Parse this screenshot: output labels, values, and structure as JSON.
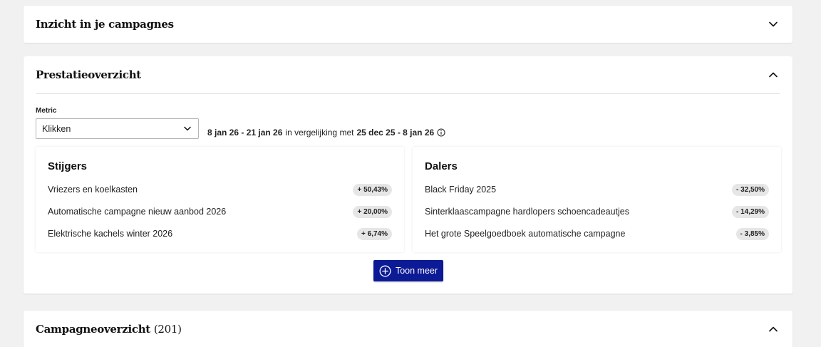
{
  "insights": {
    "title": "Inzicht in je campagnes"
  },
  "performance": {
    "title": "Prestatieoverzicht",
    "metric_label": "Metric",
    "metric_value": "Klikken",
    "range": {
      "current": "8 jan 26 - 21 jan 26",
      "connector": "in vergelijking met",
      "previous": "25 dec 25 - 8 jan 26"
    },
    "risers": {
      "title": "Stijgers",
      "items": [
        {
          "name": "Vriezers en koelkasten",
          "change": "+ 50,43%"
        },
        {
          "name": "Automatische campagne nieuw aanbod 2026",
          "change": "+ 20,00%"
        },
        {
          "name": "Elektrische kachels winter 2026",
          "change": "+ 6,74%"
        }
      ]
    },
    "fallers": {
      "title": "Dalers",
      "items": [
        {
          "name": "Black Friday 2025",
          "change": "- 32,50%"
        },
        {
          "name": "Sinterklaascampagne hardlopers schoencadeautjes",
          "change": "- 14,29%"
        },
        {
          "name": "Het grote Speelgoedboek automatische campagne",
          "change": "- 3,85%"
        }
      ]
    },
    "show_more": "Toon meer"
  },
  "campaigns": {
    "title": "Campagneoverzicht",
    "count": "(201)"
  },
  "colors": {
    "primary_button": "#0c1a95",
    "badge_bg": "#e6e6e6",
    "page_bg": "#f1f1f1"
  },
  "icons": {
    "chevron_down": "chevron-down-icon",
    "chevron_up": "chevron-up-icon",
    "info": "info-icon",
    "plus_circle": "plus-circle-icon"
  }
}
